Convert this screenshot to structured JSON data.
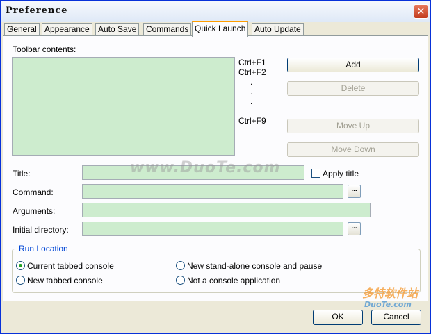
{
  "window": {
    "title": "Preference",
    "close_glyph": "✕"
  },
  "tabs": [
    {
      "label": "General",
      "active": false
    },
    {
      "label": "Appearance",
      "active": false
    },
    {
      "label": "Auto Save",
      "active": false
    },
    {
      "label": "Commands",
      "active": false
    },
    {
      "label": "Quick Launch",
      "active": true
    },
    {
      "label": "Auto Update",
      "active": false
    }
  ],
  "toolbar": {
    "label": "Toolbar contents:",
    "shortcuts": {
      "first": "Ctrl+F1",
      "second": "Ctrl+F2",
      "dot": ".",
      "last": "Ctrl+F9"
    }
  },
  "buttons": {
    "add": "Add",
    "delete": "Delete",
    "move_up": "Move Up",
    "move_down": "Move Down",
    "browse": "...",
    "ok": "OK",
    "cancel": "Cancel"
  },
  "fields": {
    "title": {
      "label": "Title:",
      "value": ""
    },
    "apply_title": {
      "label": "Apply title",
      "checked": false
    },
    "command": {
      "label": "Command:",
      "value": ""
    },
    "arguments": {
      "label": "Arguments:",
      "value": ""
    },
    "initial_directory": {
      "label": "Initial directory:",
      "value": ""
    }
  },
  "run_location": {
    "label": "Run Location",
    "options": [
      {
        "label": "Current tabbed console",
        "checked": true
      },
      {
        "label": "New stand-alone console and pause",
        "checked": false
      },
      {
        "label": "New tabbed console",
        "checked": false
      },
      {
        "label": "Not a console application",
        "checked": false
      }
    ]
  },
  "watermark": {
    "text": "www.DuoTe.com",
    "brand": "多特软件站",
    "brand_url": "DuoTe.com"
  },
  "colors": {
    "field_bg": "#cdecce",
    "accent": "#0046d5",
    "tab_highlight": "#ff9e00"
  }
}
